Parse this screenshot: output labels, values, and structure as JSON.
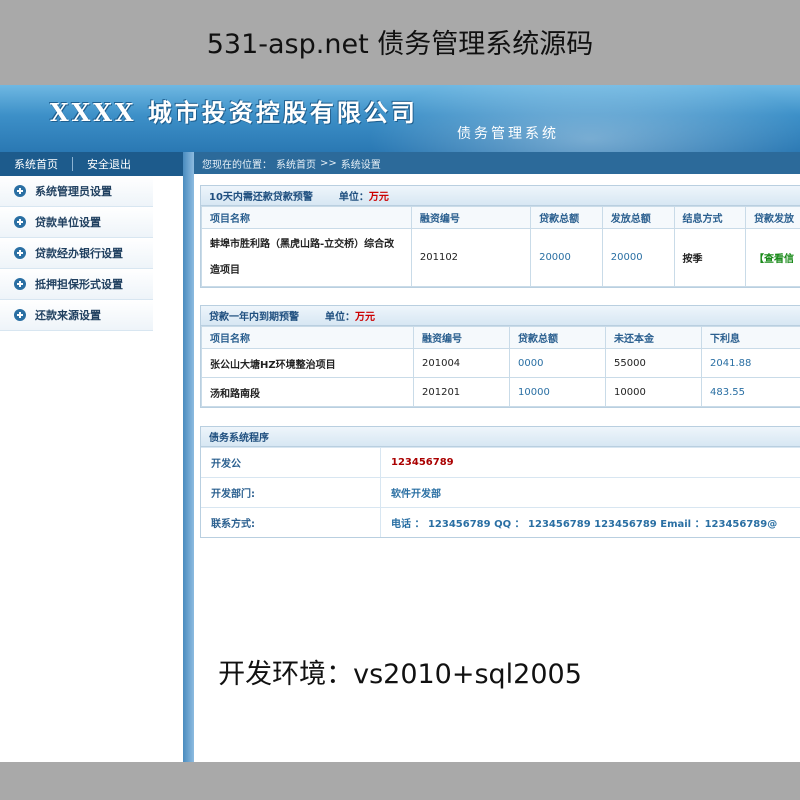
{
  "captions": {
    "top": "531-asp.net 债务管理系统源码",
    "bottom": "开发环境：vs2010+sql2005"
  },
  "header": {
    "company_name": "XXXX 城市投资控股有限公司",
    "system_subtitle": "债务管理系统"
  },
  "sidebar": {
    "top_links": [
      "系统首页",
      "安全退出"
    ],
    "items": [
      {
        "label": "系统管理员设置"
      },
      {
        "label": "贷款单位设置"
      },
      {
        "label": "贷款经办银行设置"
      },
      {
        "label": "抵押担保形式设置"
      },
      {
        "label": "还款来源设置"
      }
    ]
  },
  "breadcrumb": {
    "prefix": "您现在的位置：",
    "home": "系统首页",
    "separator": ">>",
    "current": "系统设置"
  },
  "panel1": {
    "title": "10天内需还款贷款预警",
    "unit_label": "单位：",
    "unit_value": "万元",
    "headers": [
      "项目名称",
      "融资编号",
      "贷款总额",
      "发放总额",
      "结息方式",
      "贷款发放"
    ],
    "rows": [
      {
        "name": "蚌埠市胜利路（黑虎山路-立交桥）综合改造项目",
        "code": "201102",
        "total": "20000",
        "issued": "20000",
        "interest": "按季",
        "action": "【查看信"
      }
    ]
  },
  "panel2": {
    "title": "贷款一年内到期预警",
    "unit_label": "单位：",
    "unit_value": "万元",
    "headers": [
      "项目名称",
      "融资编号",
      "贷款总额",
      "未还本金",
      "下利息"
    ],
    "rows": [
      {
        "name": "张公山大塘HZ环境整治项目",
        "code": "201004",
        "total": "0000",
        "remaining": "55000",
        "interest": "2041.88"
      },
      {
        "name": "汤和路南段",
        "code": "201201",
        "total": "10000",
        "remaining": "10000",
        "interest": "483.55"
      }
    ]
  },
  "panel3": {
    "title": "债务系统程序",
    "rows": [
      {
        "label": "开发公",
        "value": "123456789"
      },
      {
        "label": "开发部门:",
        "value": "软件开发部"
      },
      {
        "label": "联系方式:",
        "value": "电话 ： 123456789  QQ ： 123456789   123456789   Email ：123456789@"
      }
    ]
  },
  "colors": {
    "header_blue": "#3d90c8",
    "nav_dark": "#1d5b8c",
    "warning_red": "#cc0000"
  }
}
